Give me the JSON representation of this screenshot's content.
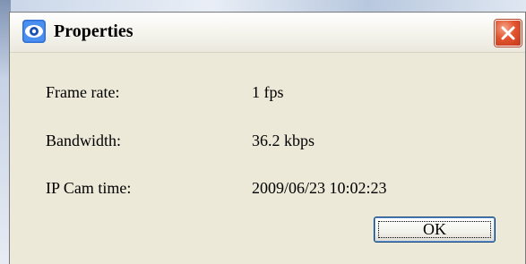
{
  "window": {
    "title": "Properties",
    "icon": "eye-app-icon",
    "close_icon": "close-icon"
  },
  "properties": [
    {
      "label": "Frame rate:",
      "value": "1 fps"
    },
    {
      "label": "Bandwidth:",
      "value": "36.2 kbps"
    },
    {
      "label": "IP Cam time:",
      "value": "2009/06/23 10:02:23"
    }
  ],
  "buttons": {
    "ok_label": "OK"
  },
  "colors": {
    "dialog_face": "#ece9d8",
    "close_button": "#d9492a",
    "focus_border": "#003c74"
  }
}
